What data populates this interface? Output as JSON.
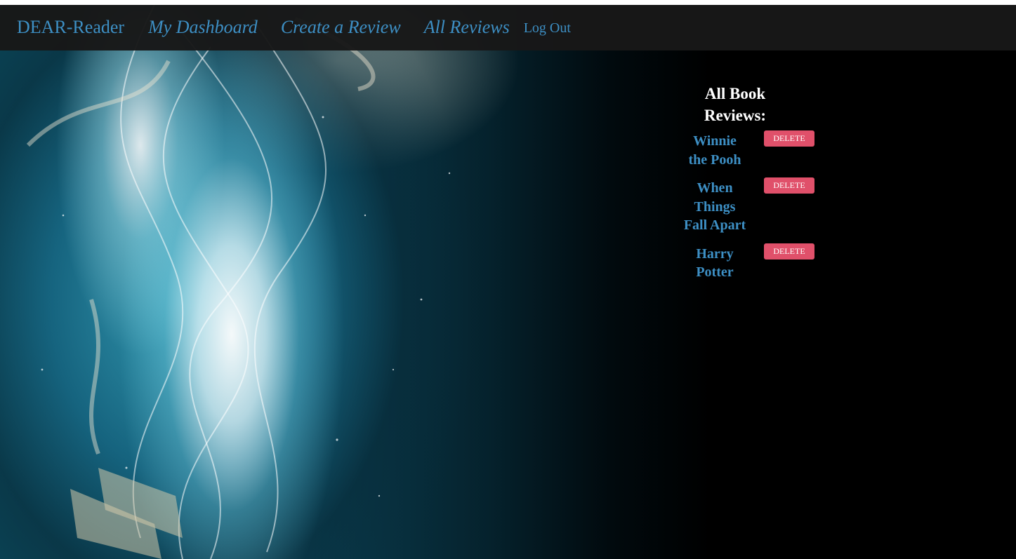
{
  "colors": {
    "nav_background": "#181818",
    "link_blue": "#3d8fc4",
    "delete_red": "#e0506a",
    "heading_white": "#ffffff",
    "page_background": "#000000"
  },
  "navbar": {
    "brand": "DEAR-Reader",
    "links": [
      {
        "label": "My Dashboard"
      },
      {
        "label": "Create a Review"
      },
      {
        "label": "All Reviews"
      }
    ],
    "logout": "Log Out"
  },
  "reviews": {
    "heading": "All Book Reviews:",
    "delete_label": "DELETE",
    "items": [
      {
        "title": "Winnie the Pooh"
      },
      {
        "title": "When Things Fall Apart"
      },
      {
        "title": "Harry Potter"
      }
    ]
  }
}
